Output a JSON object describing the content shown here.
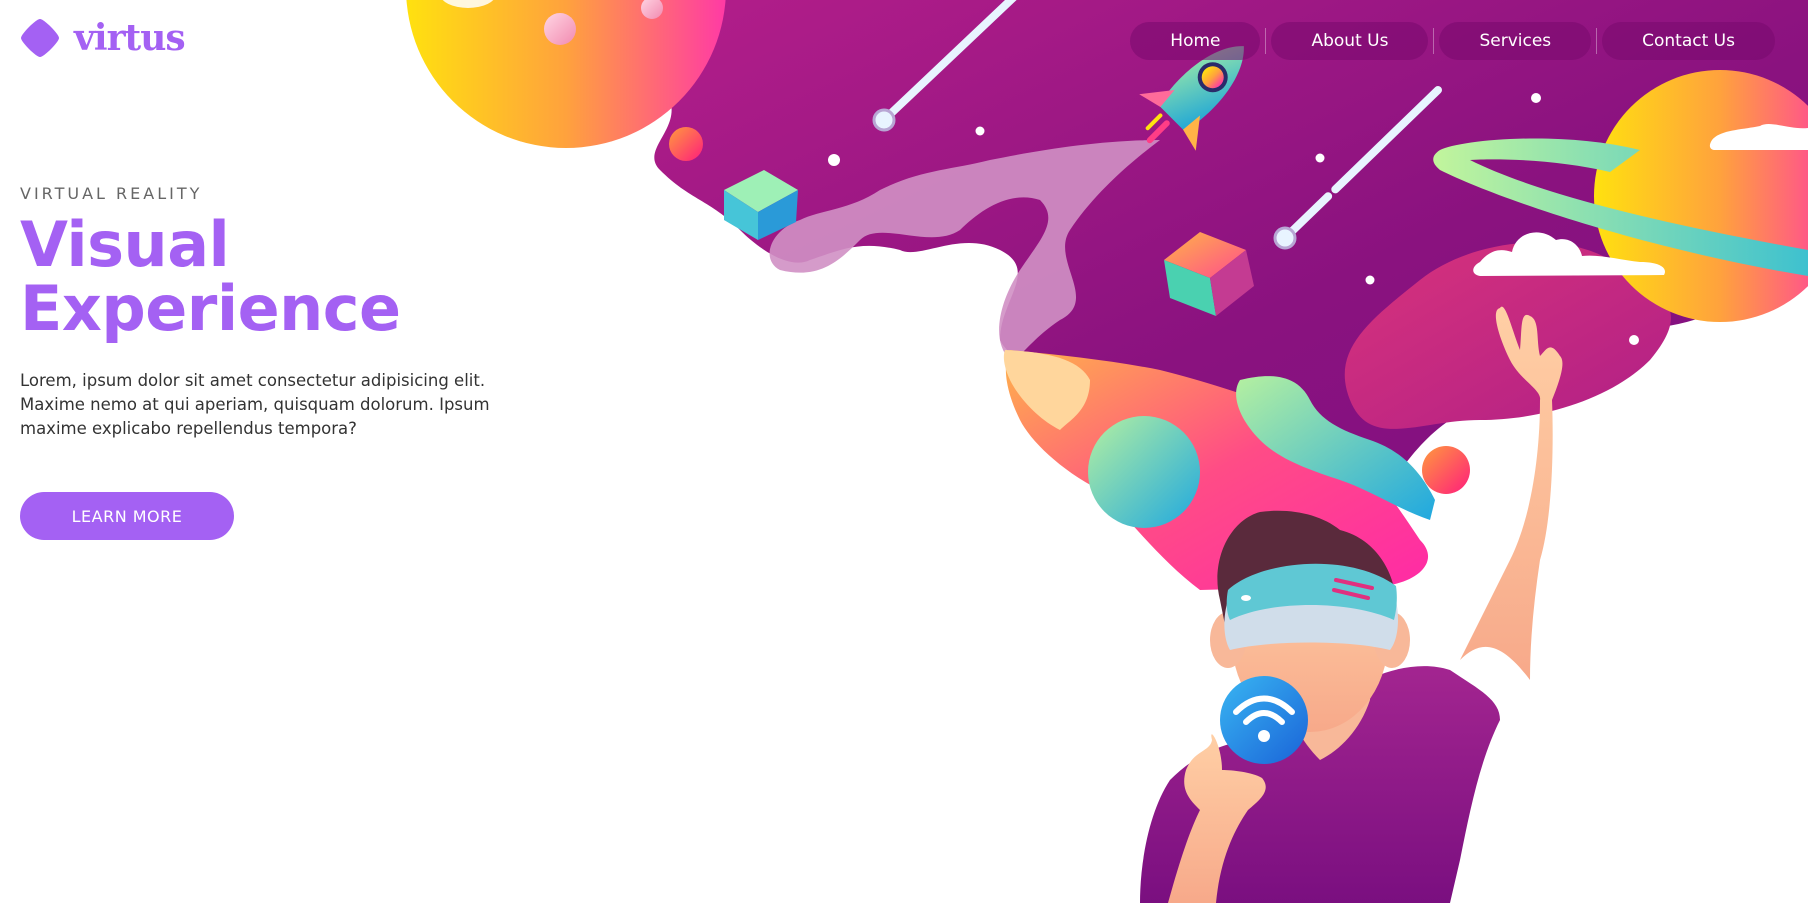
{
  "brand": {
    "name": "virtus",
    "icon": "diamond-logo-icon",
    "color": "#a461f3"
  },
  "nav": {
    "items": [
      {
        "label": "Home"
      },
      {
        "label": "About Us"
      },
      {
        "label": "Services"
      },
      {
        "label": "Contact Us"
      }
    ]
  },
  "hero": {
    "eyebrow": "VIRTUAL REALITY",
    "title_line1": "Visual",
    "title_line2": "Experience",
    "description": "Lorem, ipsum dolor sit amet consectetur adipisicing elit. Maxime nemo at qui aperiam, quisquam dolorum. Ipsum maxime explicabo repellendus tempora?",
    "cta_label": "LEARN MORE"
  },
  "colors": {
    "accent": "#a461f3",
    "sky_purple": "#8e1480",
    "sky_magenta": "#c0267f",
    "orange": "#ff9a3d",
    "yellow": "#ffe11a",
    "pink": "#ff2d8a",
    "teal": "#3fc2d8"
  },
  "illustration": {
    "subject": "person-wearing-vr-headset",
    "icons": [
      "rocket-icon",
      "planet-icon",
      "wifi-icon",
      "cube-icon",
      "cloud-icon",
      "meteor-icon"
    ]
  }
}
